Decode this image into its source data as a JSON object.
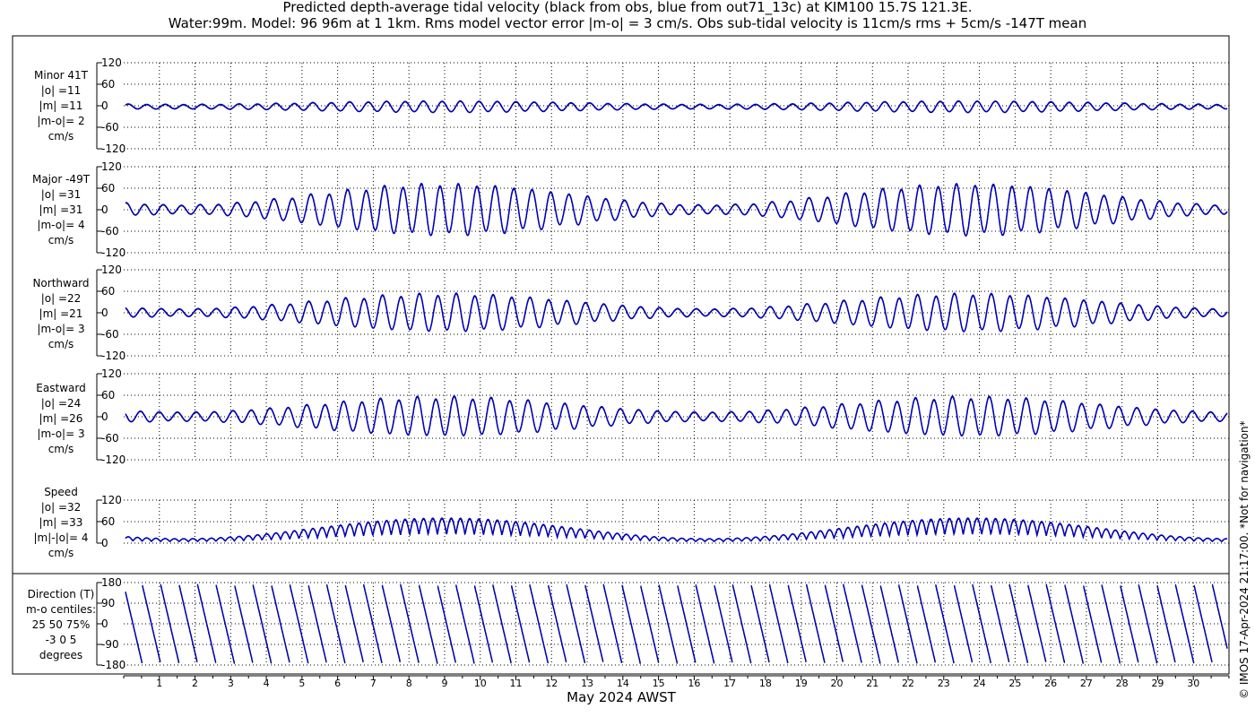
{
  "title_line1": "Predicted depth-average tidal velocity (black from obs, blue from out71_13c) at KIM100 15.7S 121.3E.",
  "title_line2": "Water:99m. Model: 96 96m at 1 1km. Rms model vector error |m-o| = 3 cm/s. Obs sub-tidal velocity is 11cm/s rms + 5cm/s -147T mean",
  "watermark": "© IMOS 17-Apr-2024 21:17:00. *Not for navigation*",
  "colors": {
    "obs": "#000000",
    "model": "#0000cc"
  },
  "chart_data": [
    {
      "type": "line",
      "id": "minor",
      "label_lines": [
        "Minor 41T",
        "|o| =11",
        "|m| =11",
        "|m-o|= 2",
        "cm/s"
      ],
      "ylim": [
        -120,
        120
      ],
      "yticks": [
        120,
        60,
        0,
        -60,
        -120
      ],
      "amplitude_range": [
        6,
        15
      ],
      "offset": -3
    },
    {
      "type": "line",
      "id": "major",
      "label_lines": [
        "Major -49T",
        "|o| =31",
        "|m| =31",
        "|m-o|= 4",
        "cm/s"
      ],
      "ylim": [
        -120,
        120
      ],
      "yticks": [
        120,
        60,
        0,
        -60,
        -120
      ],
      "amplitude_range": [
        12,
        68
      ],
      "offset": 0
    },
    {
      "type": "line",
      "id": "northward",
      "label_lines": [
        "Northward",
        "|o| =22",
        "|m| =21",
        "|m-o|= 3",
        "cm/s"
      ],
      "ylim": [
        -120,
        120
      ],
      "yticks": [
        120,
        60,
        0,
        -60,
        -120
      ],
      "amplitude_range": [
        10,
        50
      ],
      "offset": 0
    },
    {
      "type": "line",
      "id": "eastward",
      "label_lines": [
        "Eastward",
        "|o| =24",
        "|m| =26",
        "|m-o|= 3",
        "cm/s"
      ],
      "ylim": [
        -120,
        120
      ],
      "yticks": [
        120,
        60,
        0,
        -60,
        -120
      ],
      "amplitude_range": [
        12,
        52
      ],
      "offset": 0
    },
    {
      "type": "line",
      "id": "speed",
      "label_lines": [
        "Speed",
        "|o| =32",
        "|m| =33",
        "|m|-|o|= 4",
        "cm/s"
      ],
      "ylim": [
        0,
        120
      ],
      "yticks": [
        120,
        60,
        0
      ],
      "amplitude_range": [
        12,
        68
      ],
      "offset": 0
    },
    {
      "type": "line",
      "id": "direction",
      "label_lines": [
        "Direction (T)",
        "m-o centiles:",
        "25  50  75%",
        "-3  0  5",
        "degrees"
      ],
      "ylim": [
        -180,
        180
      ],
      "yticks": [
        180,
        90,
        0,
        -90,
        -180
      ],
      "amplitude_range": [
        0,
        0
      ],
      "offset": 0
    }
  ],
  "x_axis": {
    "xlabel": "May 2024 AWST",
    "day_range": [
      0,
      31
    ],
    "ticks": [
      1,
      2,
      3,
      4,
      5,
      6,
      7,
      8,
      9,
      10,
      11,
      12,
      13,
      14,
      15,
      16,
      17,
      18,
      19,
      20,
      21,
      22,
      23,
      24,
      25,
      26,
      27,
      28,
      29,
      30
    ],
    "tick_labels": [
      "1",
      "2",
      "3",
      "4",
      "5",
      "6",
      "7",
      "8",
      "9",
      "10",
      "11",
      "12",
      "13",
      "14",
      "15",
      "16",
      "17",
      "18",
      "19",
      "20",
      "21",
      "22",
      "23",
      "24",
      "25",
      "26",
      "27",
      "28",
      "29",
      "30"
    ],
    "grid": true
  }
}
